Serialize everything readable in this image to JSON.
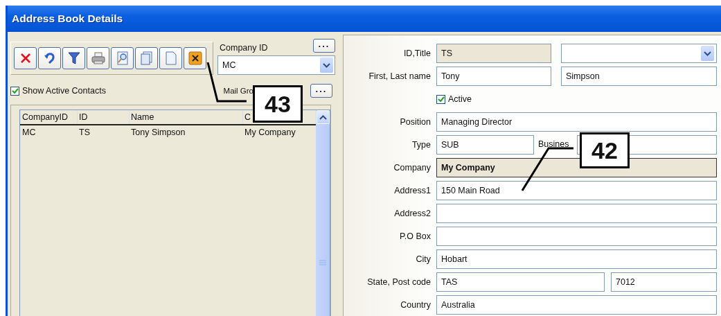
{
  "window": {
    "title": "Address Book Details"
  },
  "toolbar": {
    "buttons": [
      {
        "kind": "delete"
      },
      {
        "kind": "undo"
      },
      {
        "kind": "filter"
      },
      {
        "kind": "print"
      },
      {
        "kind": "preview"
      },
      {
        "kind": "copy"
      },
      {
        "kind": "new"
      },
      {
        "kind": "close"
      }
    ]
  },
  "company_id": {
    "label": "Company ID",
    "value": "MC",
    "browse": "..."
  },
  "show_active_contacts": {
    "label": "Show Active Contacts",
    "checked": true
  },
  "mail_group": {
    "label": "Mail Gro",
    "browse": "..."
  },
  "contacts_table": {
    "columns": [
      "CompanyID",
      "ID",
      "Name",
      "C"
    ],
    "rows": [
      [
        "MC",
        "TS",
        "Tony Simpson",
        "My Company"
      ]
    ]
  },
  "details": [
    {
      "kind": "fields",
      "label": "ID,Title",
      "fields": [
        {
          "kind": "text",
          "value": "TS",
          "readonly": true
        },
        {
          "kind": "dropdown"
        }
      ]
    },
    {
      "kind": "fields",
      "label": "First, Last name",
      "fields": [
        {
          "kind": "text",
          "value": "Tony"
        },
        {
          "kind": "text",
          "value": "Simpson"
        }
      ]
    },
    {
      "kind": "checkbox",
      "label": "Active",
      "checked": true
    },
    {
      "kind": "fields",
      "label": "Position",
      "fields": [
        {
          "kind": "text",
          "value": "Managing Director"
        }
      ]
    },
    {
      "kind": "fields",
      "label": "Type",
      "fields": [
        {
          "kind": "text",
          "value": "SUB"
        },
        {
          "kind": "label",
          "value": "Busines"
        },
        {
          "kind": "text"
        }
      ]
    },
    {
      "kind": "fields",
      "label": "Company",
      "fields": [
        {
          "kind": "text",
          "value": "My Company",
          "readonly": true,
          "emphasis": true
        }
      ]
    },
    {
      "kind": "fields",
      "label": "Address1",
      "fields": [
        {
          "kind": "text",
          "value": "150 Main Road"
        }
      ]
    },
    {
      "kind": "fields",
      "label": "Address2",
      "fields": [
        {
          "kind": "text"
        }
      ]
    },
    {
      "kind": "fields",
      "label": "P.O Box",
      "fields": [
        {
          "kind": "text"
        }
      ]
    },
    {
      "kind": "fields",
      "label": "City",
      "fields": [
        {
          "kind": "text",
          "value": "Hobart"
        }
      ]
    },
    {
      "kind": "fields",
      "label": "State, Post code",
      "fields": [
        {
          "kind": "text",
          "value": "TAS"
        },
        {
          "kind": "text",
          "value": "7012"
        }
      ]
    },
    {
      "kind": "fields",
      "label": "Country",
      "fields": [
        {
          "kind": "text",
          "value": "Australia"
        }
      ]
    }
  ],
  "callouts": [
    {
      "number": "43"
    },
    {
      "number": "42"
    }
  ]
}
